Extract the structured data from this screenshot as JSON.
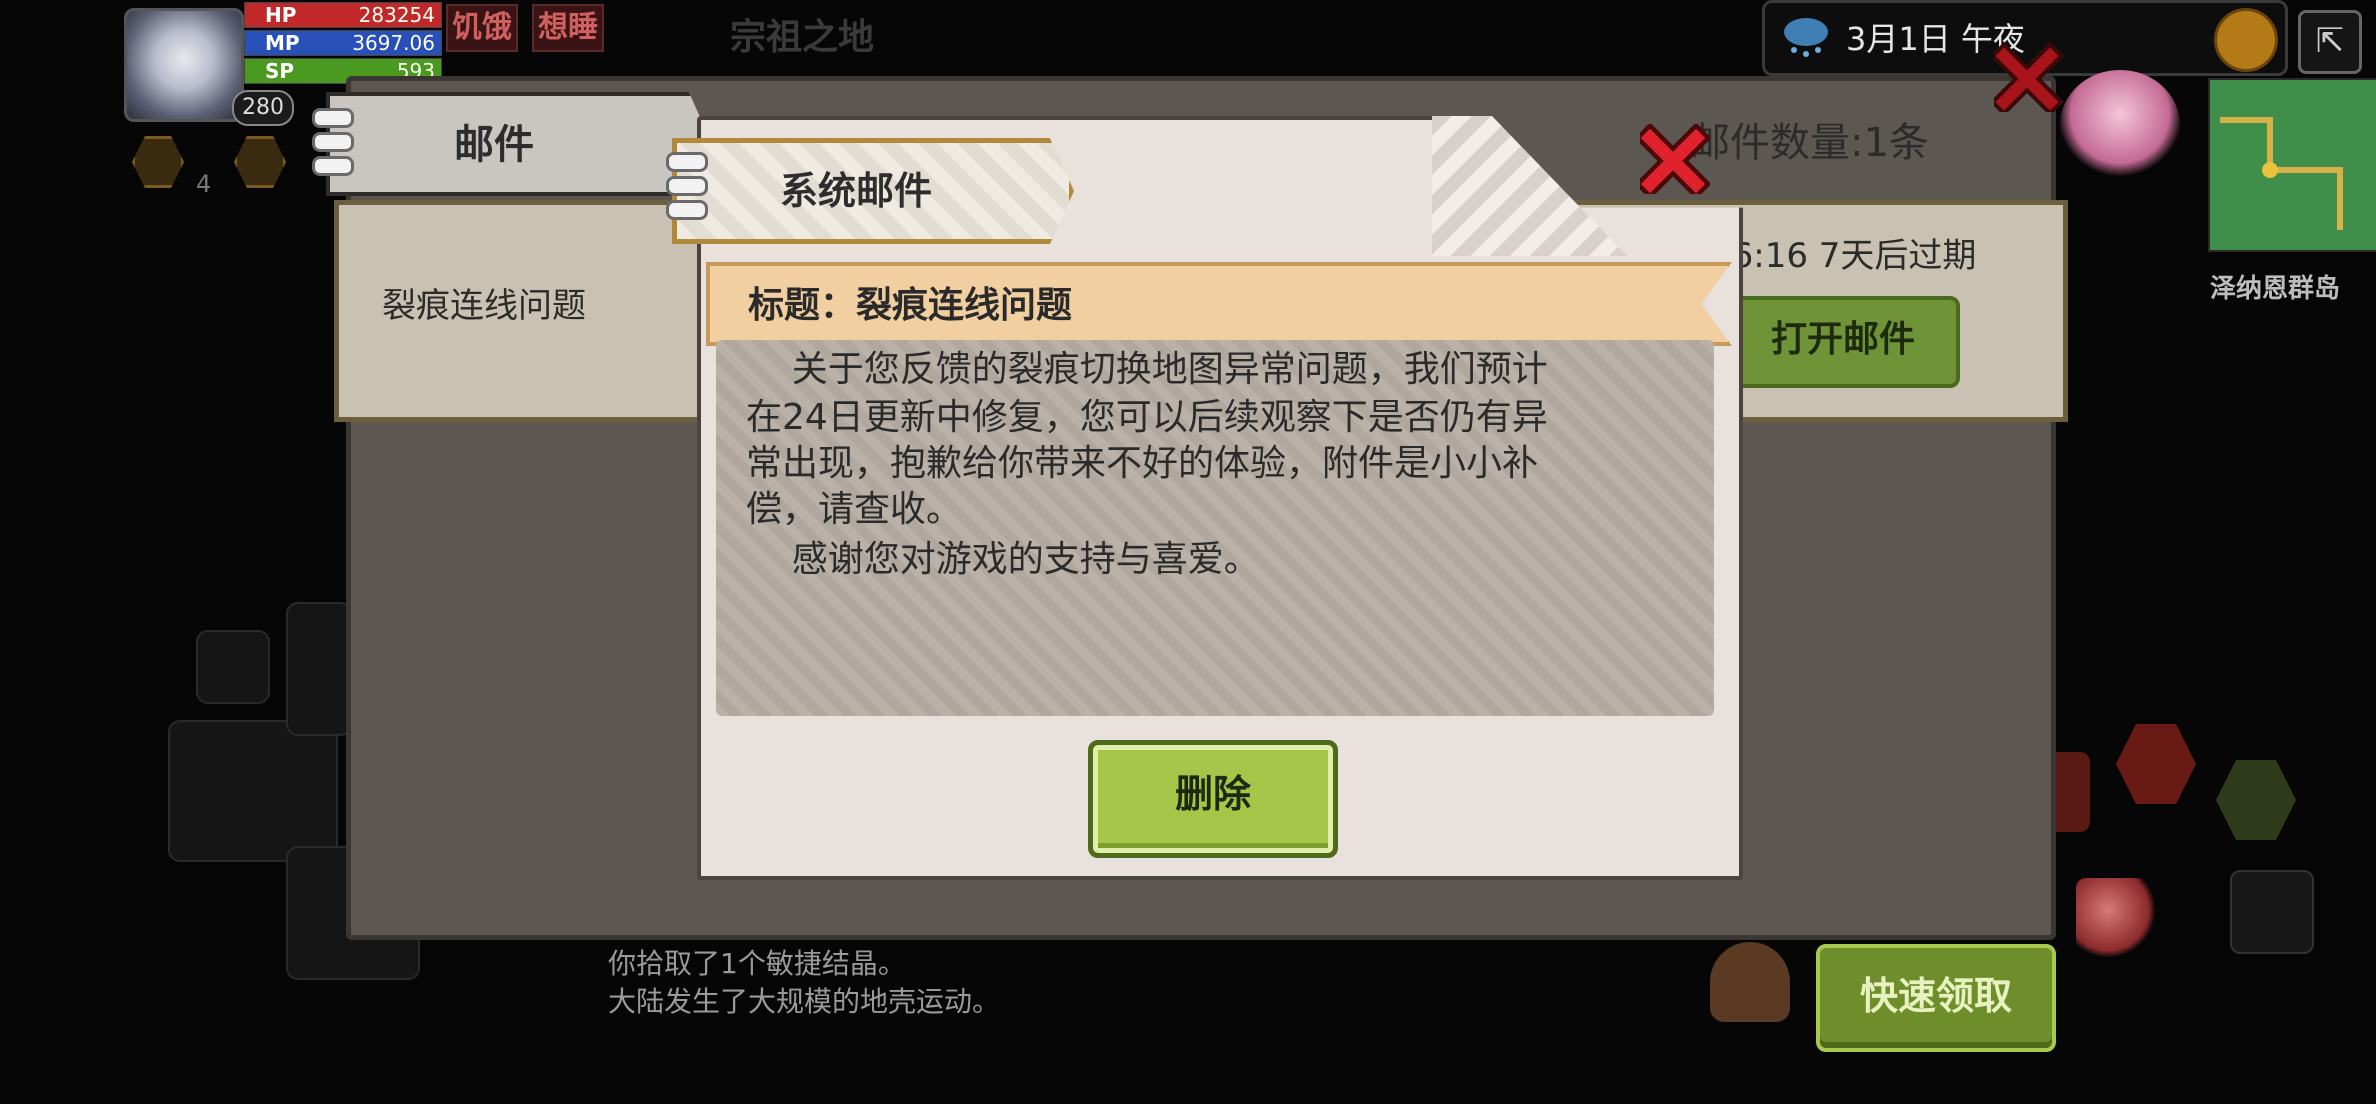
{
  "hud": {
    "level": "280",
    "stats": [
      {
        "key": "HP",
        "value": "283254",
        "color": "#d83a3a"
      },
      {
        "key": "MP",
        "value": "3697.06",
        "color": "#3a68d8"
      },
      {
        "key": "SP",
        "value": "593",
        "color": "#5aa82e"
      }
    ],
    "status_hungry": "饥饿",
    "status_sleepy": "想睡",
    "item_count": "4",
    "zone_name": "宗祖之地",
    "weather_datetime": "3月1日  午夜",
    "map_name": "泽纳恩群岛",
    "log_lines": [
      "你拾取了1个敏捷结晶。",
      "大陆发生了大规模的地壳运动。"
    ],
    "quick_collect_label": "快速领取"
  },
  "mail_window": {
    "tab_label": "邮件",
    "count_label": "邮件数量:1条",
    "row": {
      "title": "裂痕连线问题",
      "time_label": "16:16  7天后过期",
      "open_label": "打开邮件"
    }
  },
  "letter": {
    "tab_label": "系统邮件",
    "subject_label": "标题：裂痕连线问题",
    "body_lines": [
      "    关于您反馈的裂痕切换地图异常问题，我们预计",
      "在24日更新中修复，您可以后续观察下是否仍有异",
      "常出现，抱歉给你带来不好的体验，附件是小小补",
      "偿，请查收。",
      "    感谢您对游戏的支持与喜爱。"
    ],
    "delete_label": "删除"
  },
  "colors": {
    "accent_green": "#a6c64a",
    "close_red": "#d8202a",
    "subject_banner": "#f1cfa0"
  },
  "icons": [
    "close-icon",
    "weather-cloud-icon",
    "globe-icon",
    "exit-icon",
    "hex-badge-icon",
    "backpack-icon",
    "meat-icon",
    "sleep-icon"
  ]
}
